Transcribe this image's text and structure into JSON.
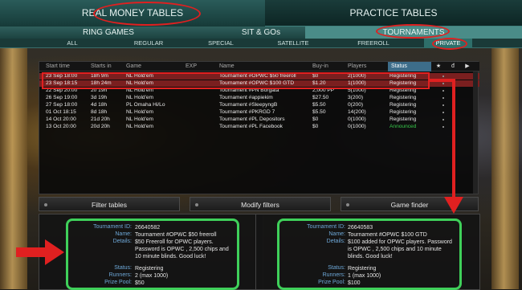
{
  "top_tabs": [
    "REAL MONEY TABLES",
    "PRACTICE TABLES"
  ],
  "game_tabs": [
    "RING GAMES",
    "SIT & GOs",
    "TOURNAMENTS"
  ],
  "filter_tabs": [
    "ALL",
    "REGULAR",
    "SPECIAL",
    "SATELLITE",
    "FREEROLL",
    "PRIVATE"
  ],
  "columns": [
    "Start time",
    "Starts in",
    "Game",
    "EXP",
    "Name",
    "Buy-in",
    "Players",
    "Status"
  ],
  "header_icons": [
    "★",
    "đ",
    "▶"
  ],
  "rows": [
    {
      "start": "23 Sep 18:00",
      "starts_in": "18h 9m",
      "game": "NL Hold'em",
      "name": "Tournament #OPWC $50 freeroll",
      "buyin": "$0",
      "players": "2(1000)",
      "status": "Registering"
    },
    {
      "start": "23 Sep 18:15",
      "starts_in": "18h 24m",
      "game": "NL Hold'em",
      "name": "Tournament #OPWC $100 GTD",
      "buyin": "$1.20",
      "players": "1(1000)",
      "status": "Registering"
    },
    {
      "start": "22 Sep 20:00",
      "starts_in": "20 19h",
      "game": "NL Hold'em",
      "name": "Tournament #PN Borgata",
      "buyin": "2,000 PP",
      "players": "5(1000)",
      "status": "Registering"
    },
    {
      "start": "26 Sep 19:00",
      "starts_in": "3d 19h",
      "game": "NL Hold'em",
      "name": "Tournament #appiekim",
      "buyin": "$27.50",
      "players": "3(200)",
      "status": "Registering"
    },
    {
      "start": "27 Sep 18:00",
      "starts_in": "4d 18h",
      "game": "PL Omaha Hi/Lo",
      "name": "Tournament #SleepyngB",
      "buyin": "$5.50",
      "players": "0(200)",
      "status": "Registering"
    },
    {
      "start": "01 Oct 18:15",
      "starts_in": "8d 18h",
      "game": "NL Hold'em",
      "name": "Tournament #PKRGD 7",
      "buyin": "$5.50",
      "players": "14(200)",
      "status": "Registering"
    },
    {
      "start": "14 Oct 20:00",
      "starts_in": "21d 20h",
      "game": "NL Hold'em",
      "name": "Tournament #PL Depositors",
      "buyin": "$0",
      "players": "0(1000)",
      "status": "Registering"
    },
    {
      "start": "13 Oct 20:00",
      "starts_in": "20d 20h",
      "game": "NL Hold'em",
      "name": "Tournament #PL Facebook",
      "buyin": "$0",
      "players": "0(1000)",
      "status": "Announced"
    }
  ],
  "buttons": [
    "Filter tables",
    "Modify filters",
    "Game finder"
  ],
  "detail_labels": [
    "Tournament ID:",
    "Name:",
    "Details:",
    "Status:",
    "Runners:",
    "Prize Pool:"
  ],
  "detail_left": {
    "id": "26640582",
    "name": "Tournament #OPWC $50 freeroll",
    "details": "$50 Freeroll for OPWC players. Password is OPWC , 2,500 chips and 10 minute blinds. Good luck!",
    "status": "Registering",
    "runners": "2 (max 1000)",
    "prize": "$50"
  },
  "detail_right": {
    "id": "26640583",
    "name": "Tournament #OPWC $100 GTD",
    "details": "$100 added for OPWC players. Password is OPWC , 2,500 chips and 10 minute blinds. Good luck!",
    "status": "Registering",
    "runners": "1 (max 1000)",
    "prize": "$100"
  },
  "colors": {
    "highlight_red": "#e02020",
    "highlight_green": "#3fd05a",
    "selected_row": "#7a1f1f",
    "announced": "#37c94b"
  }
}
